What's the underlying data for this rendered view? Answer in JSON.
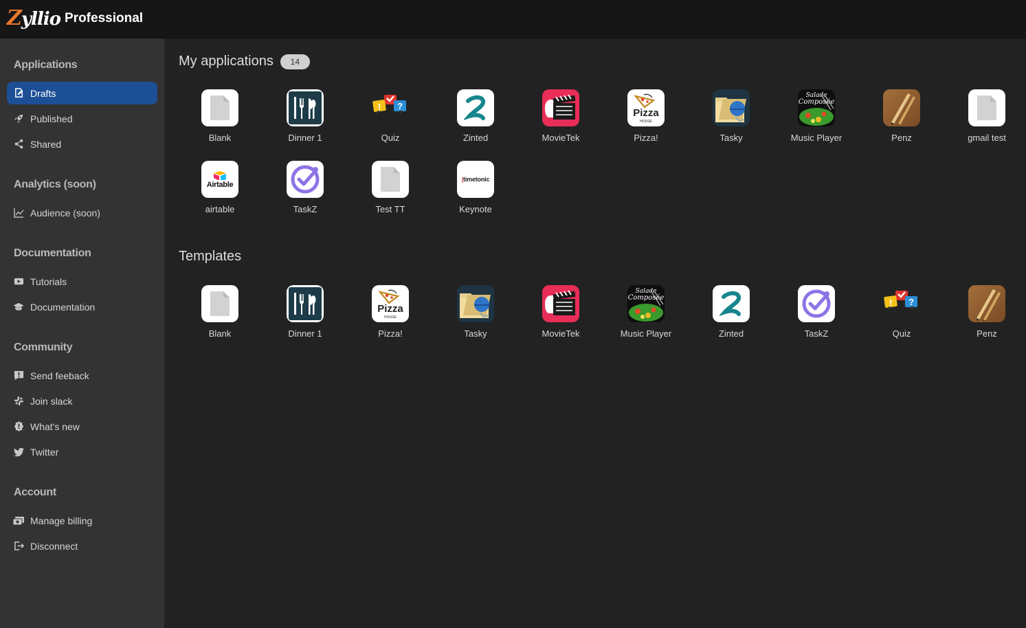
{
  "brand": {
    "mark_z": "Z",
    "mark_rest": "yllio",
    "edition": "Professional",
    "accent": "#e8782c"
  },
  "sidebar": {
    "sections": [
      {
        "title": "Applications",
        "items": [
          {
            "label": "Drafts",
            "icon": "edit-document-icon",
            "active": true
          },
          {
            "label": "Published",
            "icon": "rocket-icon"
          },
          {
            "label": "Shared",
            "icon": "share-icon"
          }
        ]
      },
      {
        "title": "Analytics (soon)",
        "items": [
          {
            "label": "Audience (soon)",
            "icon": "line-chart-icon"
          }
        ]
      },
      {
        "title": "Documentation",
        "items": [
          {
            "label": "Tutorials",
            "icon": "video-icon"
          },
          {
            "label": "Documentation",
            "icon": "graduation-cap-icon"
          }
        ]
      },
      {
        "title": "Community",
        "items": [
          {
            "label": "Send feeback",
            "icon": "feedback-icon"
          },
          {
            "label": "Join slack",
            "icon": "slack-icon"
          },
          {
            "label": "What's new",
            "icon": "news-badge-icon"
          },
          {
            "label": "Twitter",
            "icon": "twitter-icon"
          }
        ]
      },
      {
        "title": "Account",
        "items": [
          {
            "label": "Manage billing",
            "icon": "billing-icon"
          },
          {
            "label": "Disconnect",
            "icon": "logout-icon"
          }
        ]
      }
    ],
    "active_color": "#1d4f96"
  },
  "my_apps": {
    "title": "My applications",
    "count": "14",
    "apps": [
      {
        "name": "Blank",
        "icon": "blank-doc-icon"
      },
      {
        "name": "Dinner 1",
        "icon": "cutlery-icon"
      },
      {
        "name": "Quiz",
        "icon": "quiz-bubbles-icon"
      },
      {
        "name": "Zinted",
        "icon": "zinted-logo-icon"
      },
      {
        "name": "MovieTek",
        "icon": "clapperboard-icon"
      },
      {
        "name": "Pizza!",
        "icon": "pizza-house-icon"
      },
      {
        "name": "Tasky",
        "icon": "folder-helmet-icon"
      },
      {
        "name": "Music Player",
        "icon": "salad-compose-icon"
      },
      {
        "name": "Penz",
        "icon": "pens-icon"
      },
      {
        "name": "gmail test",
        "icon": "blank-doc-icon"
      },
      {
        "name": "airtable",
        "icon": "airtable-logo-icon",
        "logo_text": "Airtable"
      },
      {
        "name": "TaskZ",
        "icon": "check-circle-icon"
      },
      {
        "name": "Test TT",
        "icon": "blank-doc-icon"
      },
      {
        "name": "Keynote",
        "icon": "timetonic-logo-icon",
        "logo_text": "timetonic"
      }
    ]
  },
  "templates": {
    "title": "Templates",
    "apps": [
      {
        "name": "Blank",
        "icon": "blank-doc-icon"
      },
      {
        "name": "Dinner 1",
        "icon": "cutlery-icon"
      },
      {
        "name": "Pizza!",
        "icon": "pizza-house-icon"
      },
      {
        "name": "Tasky",
        "icon": "folder-helmet-icon"
      },
      {
        "name": "MovieTek",
        "icon": "clapperboard-icon"
      },
      {
        "name": "Music Player",
        "icon": "salad-compose-icon"
      },
      {
        "name": "Zinted",
        "icon": "zinted-logo-icon"
      },
      {
        "name": "TaskZ",
        "icon": "check-circle-icon"
      },
      {
        "name": "Quiz",
        "icon": "quiz-bubbles-icon"
      },
      {
        "name": "Penz",
        "icon": "pens-icon"
      }
    ]
  }
}
